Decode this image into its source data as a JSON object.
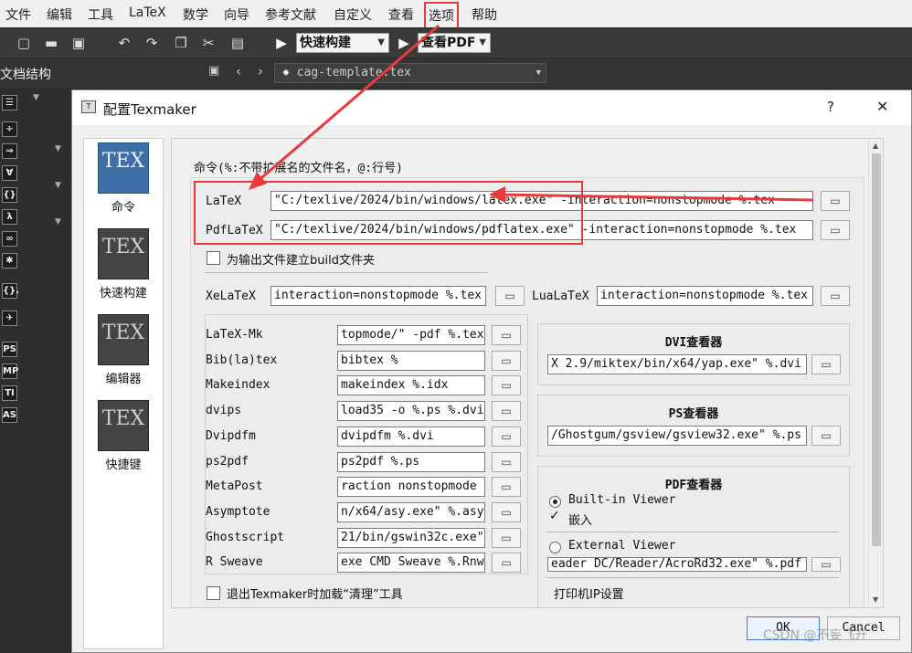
{
  "menu": [
    "文件",
    "编辑",
    "工具",
    "LaTeX",
    "数学",
    "向导",
    "参考文献",
    "自定义",
    "查看",
    "选项",
    "帮助"
  ],
  "toolbar": {
    "build_combo": "快速构建",
    "view_combo": "查看PDF"
  },
  "structure": {
    "title": "文档结构",
    "file_tab": "cag-template.tex"
  },
  "side_symbols": [
    "÷",
    "⇒",
    "∀",
    "{}",
    "λ",
    "∞",
    "✱",
    "{}.",
    "✈",
    "PS",
    "MP",
    "TI",
    "AS"
  ],
  "dialog": {
    "title": "配置Texmaker",
    "help": "?",
    "close": "✕",
    "categories": [
      {
        "label": "命令",
        "icon": "TEX"
      },
      {
        "label": "快速构建",
        "icon": "TEX"
      },
      {
        "label": "编辑器",
        "icon": "TEX"
      },
      {
        "label": "快捷键",
        "icon": "TEX"
      }
    ],
    "section_title": "命令(%:不带扩展名的文件名，@:行号)",
    "latex": {
      "label": "LaTeX",
      "value": "\"C:/texlive/2024/bin/windows/latex.exe\" -interaction=nonstopmode %.tex"
    },
    "pdflatex": {
      "label": "PdfLaTeX",
      "value": "\"C:/texlive/2024/bin/windows/pdflatex.exe\" -interaction=nonstopmode %.tex"
    },
    "build_folder": "为输出文件建立build文件夹",
    "xelatex": {
      "label": "XeLaTeX",
      "value": "interaction=nonstopmode %.tex"
    },
    "lualatex": {
      "label": "LuaLaTeX",
      "value": "interaction=nonstopmode %.tex"
    },
    "tools": [
      {
        "label": "LaTeX-Mk",
        "value": "topmode/\" -pdf %.tex"
      },
      {
        "label": "Bib(la)tex",
        "value": "bibtex %"
      },
      {
        "label": "Makeindex",
        "value": "makeindex %.idx"
      },
      {
        "label": "dvips",
        "value": "load35 -o %.ps %.dvi"
      },
      {
        "label": "Dvipdfm",
        "value": "dvipdfm %.dvi"
      },
      {
        "label": "ps2pdf",
        "value": "ps2pdf %.ps"
      },
      {
        "label": "MetaPost",
        "value": "raction nonstopmode"
      },
      {
        "label": "Asymptote",
        "value": "n/x64/asy.exe\" %.asy"
      },
      {
        "label": "Ghostscript",
        "value": "21/bin/gswin32c.exe\""
      },
      {
        "label": "R Sweave",
        "value": "exe CMD Sweave %.Rnw"
      }
    ],
    "cleanup": "退出Texmaker时加载“清理”工具",
    "dvi_viewer": {
      "title": "DVI查看器",
      "value": "X 2.9/miktex/bin/x64/yap.exe\" %.dvi"
    },
    "ps_viewer": {
      "title": "PS查看器",
      "value": "/Ghostgum/gsview/gsview32.exe\" %.ps"
    },
    "pdf_viewer": {
      "title": "PDF查看器",
      "builtin": "Built-in Viewer",
      "embed": "嵌入",
      "external": "External Viewer",
      "external_value": "eader DC/Reader/AcroRd32.exe\" %.pdf"
    },
    "printer": "打印机IP设置",
    "ok": "OK",
    "cancel": "Cancel",
    "watermark": "CSDN @不妄飞升"
  },
  "colors": {
    "highlight": "#e83a3a",
    "dark_bg": "#2b2b2b"
  }
}
